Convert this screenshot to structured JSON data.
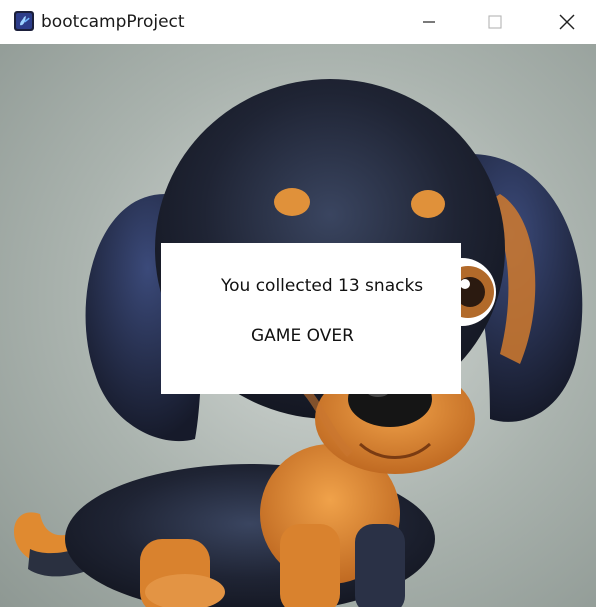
{
  "window": {
    "title": "bootcampProject",
    "icon": "app-icon",
    "controls": {
      "minimize_icon": "minimize-icon",
      "maximize_icon": "maximize-icon",
      "close_icon": "close-icon"
    }
  },
  "game": {
    "background": "puppy-illustration",
    "dialog": {
      "message": "You collected 13 snacks",
      "status": "GAME OVER"
    }
  },
  "colors": {
    "titlebar_bg": "#ffffff",
    "dialog_bg": "#ffffff",
    "text": "#111111"
  }
}
